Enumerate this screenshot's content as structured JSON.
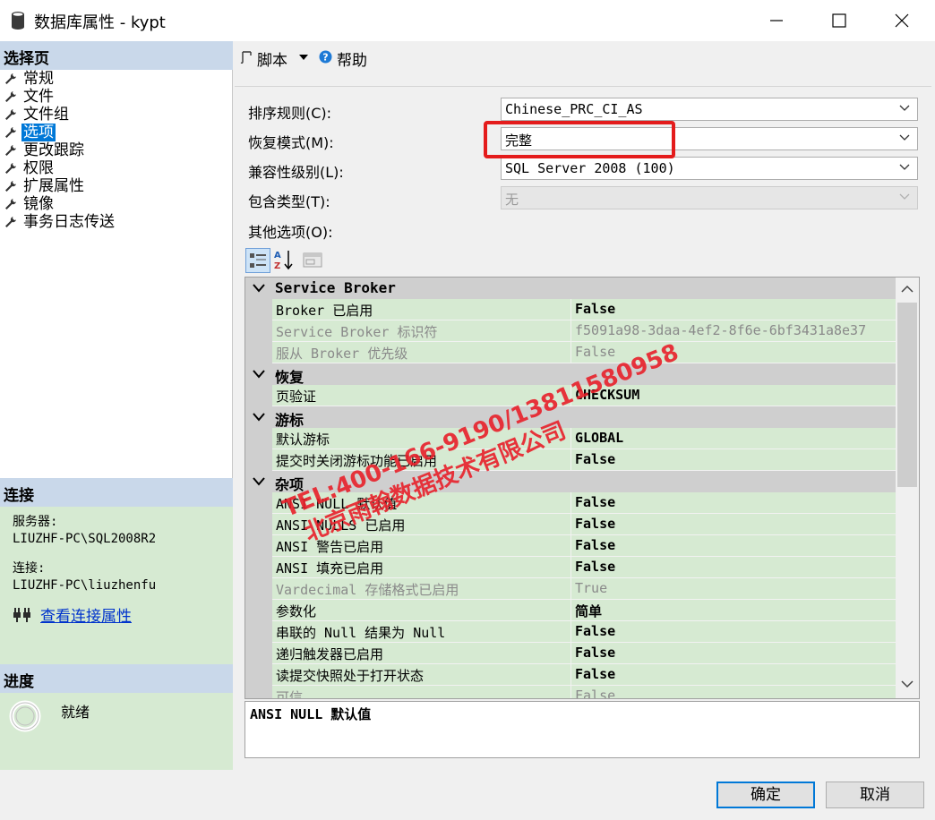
{
  "window": {
    "title": "数据库属性 - kypt"
  },
  "left": {
    "select_page_header": "选择页",
    "pages": [
      "常规",
      "文件",
      "文件组",
      "选项",
      "更改跟踪",
      "权限",
      "扩展属性",
      "镜像",
      "事务日志传送"
    ],
    "selected_page": "选项",
    "connection_header": "连接",
    "server_label": "服务器:",
    "server_value": "LIUZHF-PC\\SQL2008R2",
    "connection_label": "连接:",
    "connection_value": "LIUZHF-PC\\liuzhenfu",
    "view_conn_props": "查看连接属性",
    "progress_header": "进度",
    "progress_status": "就绪"
  },
  "toolbar": {
    "script_label": "脚本",
    "help_label": "帮助"
  },
  "form": {
    "collation_label": "排序规则(C):",
    "collation_value": "Chinese_PRC_CI_AS",
    "recovery_label": "恢复模式(M):",
    "recovery_value": "完整",
    "compat_label": "兼容性级别(L):",
    "compat_value": "SQL Server 2008 (100)",
    "containment_label": "包含类型(T):",
    "containment_value": "无",
    "other_label": "其他选项(O):"
  },
  "grid": {
    "sections": [
      {
        "name": "Service Broker",
        "rows": [
          {
            "name": "Broker 已启用",
            "value": "False",
            "readonly": false
          },
          {
            "name": "Service Broker 标识符",
            "value": "f5091a98-3daa-4ef2-8f6e-6bf3431a8e37",
            "readonly": true
          },
          {
            "name": "服从 Broker 优先级",
            "value": "False",
            "readonly": true
          }
        ]
      },
      {
        "name": "恢复",
        "rows": [
          {
            "name": "页验证",
            "value": "CHECKSUM",
            "readonly": false
          }
        ]
      },
      {
        "name": "游标",
        "rows": [
          {
            "name": "默认游标",
            "value": "GLOBAL",
            "readonly": false
          },
          {
            "name": "提交时关闭游标功能已启用",
            "value": "False",
            "readonly": false
          }
        ]
      },
      {
        "name": "杂项",
        "rows": [
          {
            "name": "ANSI NULL 默认值",
            "value": "False",
            "readonly": false
          },
          {
            "name": "ANSI NULLS 已启用",
            "value": "False",
            "readonly": false
          },
          {
            "name": "ANSI 警告已启用",
            "value": "False",
            "readonly": false
          },
          {
            "name": "ANSI 填充已启用",
            "value": "False",
            "readonly": false
          },
          {
            "name": "Vardecimal 存储格式已启用",
            "value": "True",
            "readonly": true
          },
          {
            "name": "参数化",
            "value": "简单",
            "readonly": false
          },
          {
            "name": "串联的 Null 结果为 Null",
            "value": "False",
            "readonly": false
          },
          {
            "name": "递归触发器已启用",
            "value": "False",
            "readonly": false
          },
          {
            "name": "读提交快照处于打开状态",
            "value": "False",
            "readonly": false
          },
          {
            "name": "可信",
            "value": "False",
            "readonly": true
          }
        ]
      }
    ],
    "description": "ANSI NULL 默认值"
  },
  "watermark": {
    "line1": "TEL:400-166-9190/13811580958",
    "line2": "北京雨翰数据技术有限公司"
  },
  "buttons": {
    "ok": "确定",
    "cancel": "取消"
  },
  "colors": {
    "selection": "#0078d7",
    "header_band": "#c9d8ea",
    "green_panel": "#d6ead2",
    "highlight_box": "#e41c1c"
  }
}
